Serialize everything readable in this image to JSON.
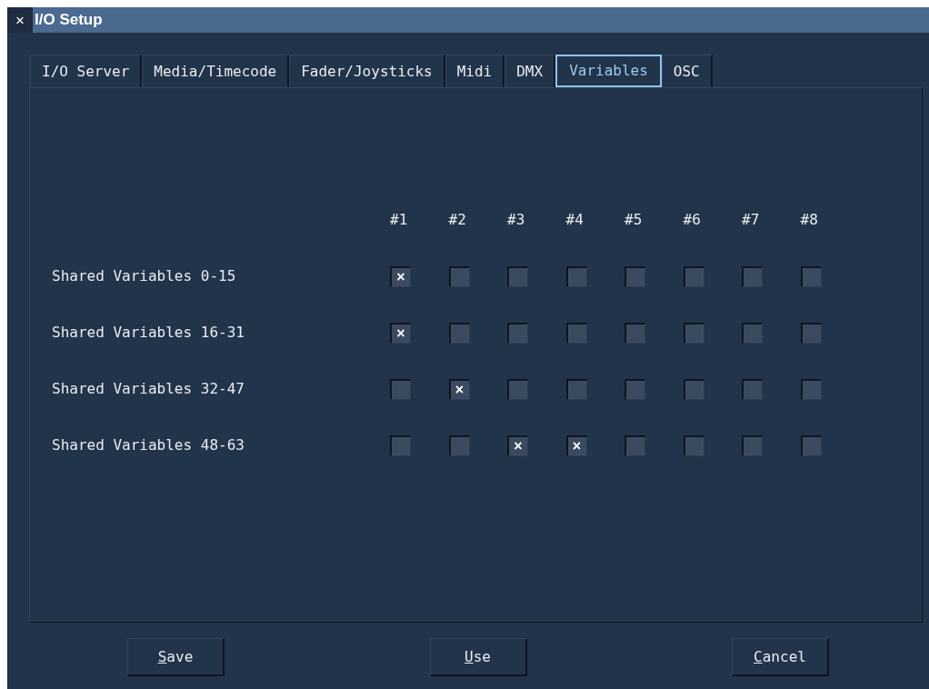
{
  "window": {
    "close": "×",
    "title": "I/O Setup"
  },
  "tabs": [
    {
      "label": "I/O Server",
      "selected": false
    },
    {
      "label": "Media/Timecode",
      "selected": false
    },
    {
      "label": "Fader/Joysticks",
      "selected": false
    },
    {
      "label": "Midi",
      "selected": false
    },
    {
      "label": "DMX",
      "selected": false
    },
    {
      "label": "Variables",
      "selected": true
    },
    {
      "label": "OSC",
      "selected": false
    }
  ],
  "columns": [
    "#1",
    "#2",
    "#3",
    "#4",
    "#5",
    "#6",
    "#7",
    "#8"
  ],
  "rows": [
    {
      "label": "Shared Variables 0-15",
      "checks": [
        {
          "checked": true
        },
        {
          "checked": false
        },
        {
          "checked": false
        },
        {
          "checked": false
        },
        {
          "checked": false
        },
        {
          "checked": false
        },
        {
          "checked": false
        },
        {
          "checked": false
        }
      ]
    },
    {
      "label": "Shared Variables 16-31",
      "checks": [
        {
          "checked": true
        },
        {
          "checked": false
        },
        {
          "checked": false
        },
        {
          "checked": false
        },
        {
          "checked": false
        },
        {
          "checked": false
        },
        {
          "checked": false
        },
        {
          "checked": false
        }
      ]
    },
    {
      "label": "Shared Variables 32-47",
      "checks": [
        {
          "checked": false
        },
        {
          "checked": true
        },
        {
          "checked": false
        },
        {
          "checked": false
        },
        {
          "checked": false
        },
        {
          "checked": false
        },
        {
          "checked": false
        },
        {
          "checked": false
        }
      ]
    },
    {
      "label": "Shared Variables 48-63",
      "checks": [
        {
          "checked": false
        },
        {
          "checked": false
        },
        {
          "checked": true
        },
        {
          "checked": true
        },
        {
          "checked": false
        },
        {
          "checked": false
        },
        {
          "checked": false
        },
        {
          "checked": false
        }
      ]
    }
  ],
  "buttons": [
    "Save",
    "Use",
    "Cancel"
  ],
  "check_mark": "×"
}
